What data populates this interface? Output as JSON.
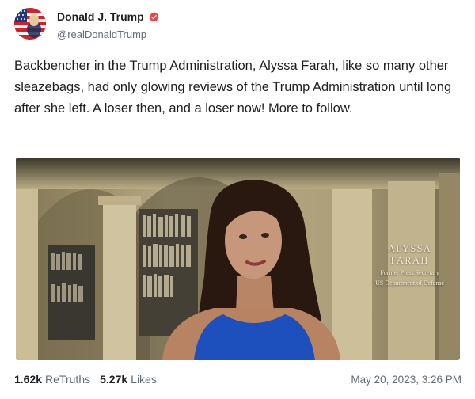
{
  "author": {
    "display_name": "Donald J. Trump",
    "handle": "@realDonaldTrump",
    "verified_icon": "verified-badge-icon",
    "avatar_icon": "flag-portrait-avatar"
  },
  "post": {
    "text": "Backbencher in the Trump Administration, Alyssa Farah, like so many other sleazebags, had only glowing reviews of the Trump Administration until long after she left. A loser then, and a loser now! More to follow."
  },
  "media": {
    "caption_name_line1": "ALYSSA",
    "caption_name_line2": "FARAH",
    "caption_title_line1": "Former Press Secretary",
    "caption_title_line2": "US Department of Defense"
  },
  "stats": {
    "retruths_count": "1.62k",
    "retruths_label": "ReTruths",
    "likes_count": "5.27k",
    "likes_label": "Likes"
  },
  "timestamp": "May 20, 2023, 3:26 PM",
  "colors": {
    "verified": "#e5484d",
    "text": "#1c1e21",
    "muted": "#636b75"
  }
}
